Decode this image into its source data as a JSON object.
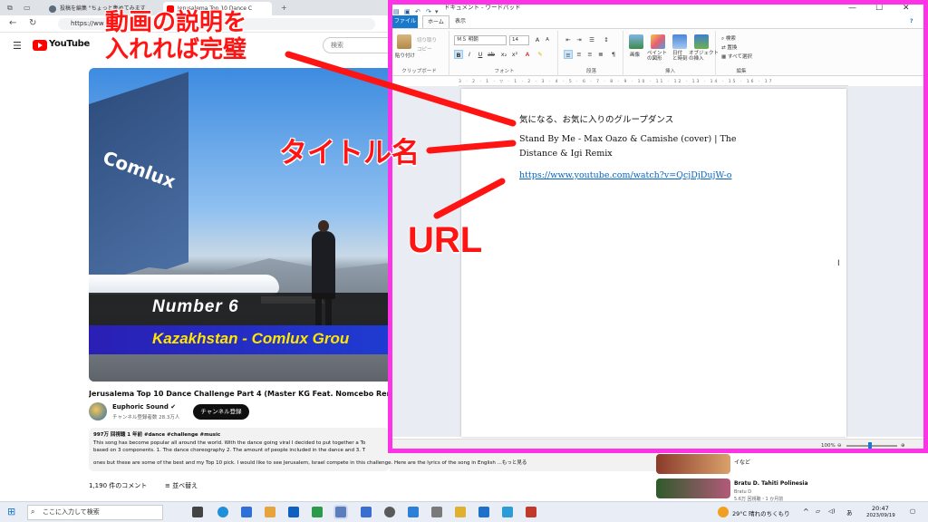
{
  "browser": {
    "tabs": [
      {
        "label": "投稿を編集 \"ちょっと集めてみます"
      },
      {
        "label": "Jerusalema Top 10 Dance C"
      }
    ],
    "url": "https://ww",
    "youtube": {
      "logo_text": "YouTube",
      "search_placeholder": "検索",
      "video_overlay": {
        "line1": "Number 6",
        "line2": "Kazakhstan - Comlux Grou",
        "hangar_sign": "Comlux"
      },
      "video_title": "Jerusalema Top 10 Dance Challenge Part 4 (Master KG Feat. Nomcebo Remix)",
      "channel_name": "Euphoric Sound ✔",
      "channel_subs": "チャンネル登録者数 28.3万人",
      "subscribe_label": "チャンネル登録",
      "description": {
        "meta": "997万 回視聴  1 年前  #dance #challenge #music",
        "line1": "This song has become popular all around the world. With the dance going viral I decided to put together a To",
        "line2": "based on 3 components. 1. The dance choreography 2. The amount of people included in the dance and 3. T",
        "line3": "ones but these are some of the best and my Top 10 pick. I would like to see Jerusalem, Israel compete in this challenge. Here are the lyrics of the song in English  ...もっと見る"
      },
      "comments_count": "1,190 件のコメント",
      "sort_label": "並べ替え",
      "recommendations": [
        {
          "title": "イなど",
          "channel": ""
        },
        {
          "title": "Bratu D. Tahiti Polinesia",
          "channel": "Bratu D",
          "views": "5.6万 回視聴・1 か月前"
        }
      ]
    }
  },
  "wordpad": {
    "window_title": "ドキュメント - ワードパッド",
    "menu": {
      "file": "ファイル",
      "home": "ホーム",
      "view": "表示"
    },
    "ribbon": {
      "clipboard": {
        "paste": "貼り付け",
        "cut": "切り取り",
        "copy": "コピー",
        "label": "クリップボード"
      },
      "font": {
        "name": "ＭＳ 明朝",
        "size": "14",
        "label": "フォント"
      },
      "paragraph": {
        "label": "段落"
      },
      "insert": {
        "image": "画像",
        "paint": "ペイント\nの図形",
        "datetime": "日付\nと時刻",
        "object": "オブジェクト\nの挿入",
        "label": "挿入"
      },
      "edit": {
        "find": "検索",
        "replace": "置換",
        "select_all": "すべて選択",
        "label": "編集"
      }
    },
    "ruler": "3 · 2 · 1 · ▽ · 1 · 2 · 3 · 4 · 5 · 6 · 7 · 8 · 9 · 10 · 11 · 12 · 13 · 14 · 15 · 16 · 17",
    "document": {
      "line1": "気になる、お気に入りのグループダンス",
      "line2": "Stand By Me - Max Oazo & Camishe (cover) | The",
      "line3": "Distance & Igi Remix",
      "line4": "https://www.youtube.com/watch?v=QcjDjDujW-o"
    },
    "zoom": "100%"
  },
  "annotations": {
    "top_line1": "動画の説明を",
    "top_line2": "入れれば完璧",
    "middle": "タイトル名",
    "bottom": "URL",
    "color": "#ff1414"
  },
  "taskbar": {
    "search_placeholder": "ここに入力して検索",
    "weather": "29°C  晴れのちくもり",
    "time": "20:47",
    "date": "2023/09/19",
    "ime": "あ"
  },
  "colors": {
    "highlight_border": "#ff33e6",
    "youtube_red": "#ff0000",
    "wordpad_accent": "#1979ca",
    "link": "#0563c1"
  }
}
